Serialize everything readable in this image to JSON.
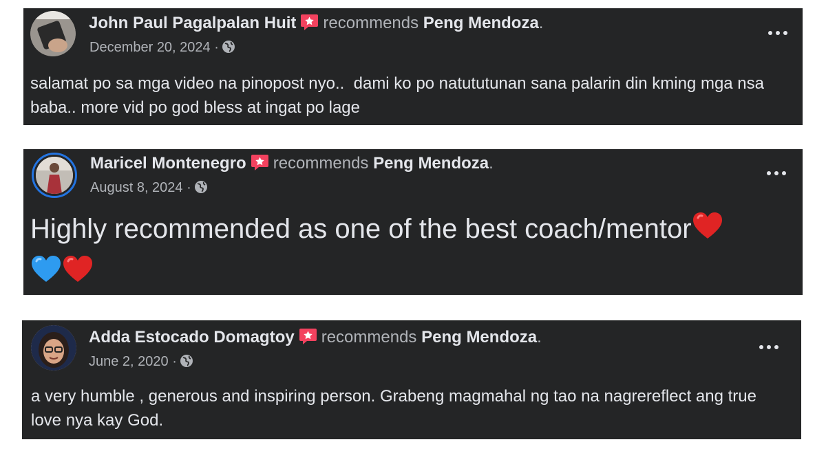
{
  "verb": "recommends",
  "page_name": "Peng Mendoza",
  "separator": "·",
  "colors": {
    "card_bg": "#242526",
    "primary_text": "#e4e6eb",
    "secondary_text": "#b0b3b8",
    "badge": "#f3425f",
    "ring": "#2374e1"
  },
  "icons": {
    "badge": "recommendation-badge-icon",
    "privacy": "globe-icon",
    "more": "more-options-icon",
    "emojis": [
      "red-heart",
      "blue-heart",
      "red-heart"
    ]
  },
  "reviews": [
    {
      "author": "John Paul Pagalpalan Huit",
      "date": "December 20, 2024",
      "text": "salamat po sa mga video na pinopost nyo..  dami ko po natututunan sana palarin din kming mga nsa baba.. more vid po god bless at ingat po lage"
    },
    {
      "author": "Maricel Montenegro",
      "date": "August 8, 2024",
      "text": "Highly recommended as one of the best coach/mentor"
    },
    {
      "author": "Adda Estocado Domagtoy",
      "date": "June 2, 2020",
      "text": "a very humble , generous and inspiring person. Grabeng magmahal ng tao na nagrereflect ang true love nya kay God."
    }
  ]
}
